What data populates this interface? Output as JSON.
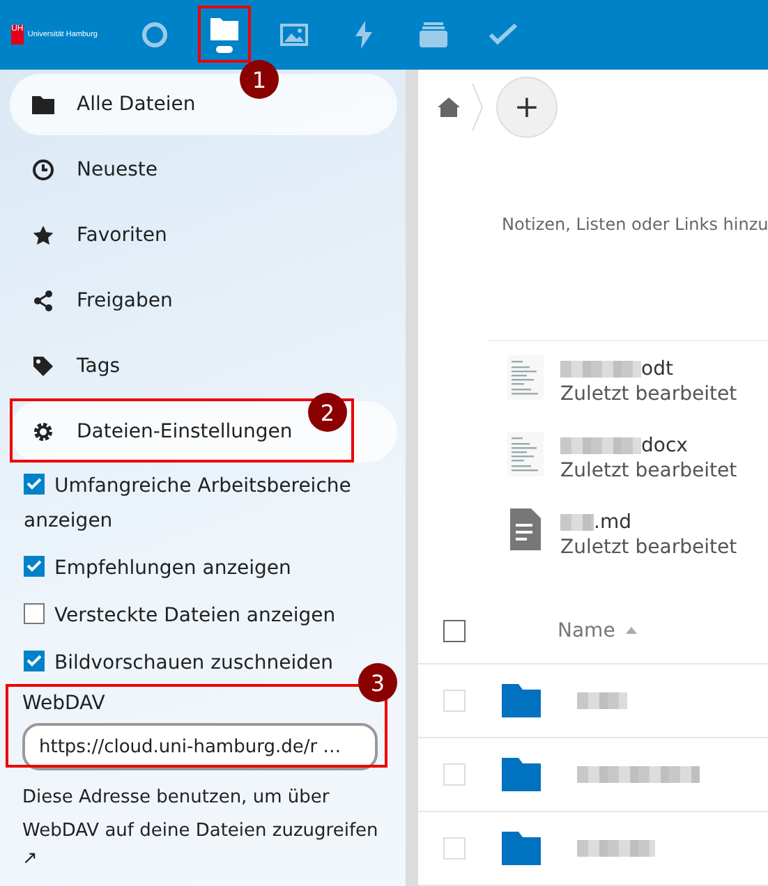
{
  "header": {
    "logo": {
      "mark": "UH",
      "name": "Universität Hamburg"
    },
    "apps": [
      {
        "kind": "circle",
        "selected": false
      },
      {
        "kind": "folder",
        "selected": true,
        "annotation": "1"
      },
      {
        "kind": "image",
        "selected": false
      },
      {
        "kind": "bolt",
        "selected": false
      },
      {
        "kind": "stack",
        "selected": false
      },
      {
        "kind": "check",
        "selected": false
      }
    ]
  },
  "sidebar": {
    "items": [
      {
        "kind": "folder",
        "label": "Alle Dateien",
        "selected": true
      },
      {
        "kind": "clock",
        "label": "Neueste",
        "selected": false
      },
      {
        "kind": "star",
        "label": "Favoriten",
        "selected": false
      },
      {
        "kind": "share",
        "label": "Freigaben",
        "selected": false
      },
      {
        "kind": "tag",
        "label": "Tags",
        "selected": false
      }
    ],
    "settings": {
      "label": "Dateien-Einstellungen",
      "expanded": true,
      "annotation": "2",
      "options": [
        {
          "label": "Umfangreiche Arbeitsbereiche anzeigen",
          "checked": true
        },
        {
          "label": "Empfehlungen anzeigen",
          "checked": true
        },
        {
          "label": "Versteckte Dateien anzeigen",
          "checked": false
        },
        {
          "label": "Bildvorschauen zuschneiden",
          "checked": true
        }
      ],
      "webdav": {
        "label": "WebDAV",
        "value": "https://cloud.uni-hamburg.de/r …",
        "annotation": "3",
        "description": "Diese Adresse benutzen, um über WebDAV auf deine Dateien zuzugreifen",
        "link": "↗"
      }
    }
  },
  "content": {
    "add_button": "+",
    "notes_hint": "Notizen, Listen oder Links hinzu",
    "recent": [
      {
        "kind": "document",
        "extension": "odt",
        "subtitle": "Zuletzt bearbeitet"
      },
      {
        "kind": "document",
        "extension": "docx",
        "subtitle": "Zuletzt bearbeitet"
      },
      {
        "kind": "text",
        "extension": ".md",
        "subtitle": "Zuletzt bearbeitet"
      }
    ],
    "table": {
      "select_all": {
        "checked": false
      },
      "columns": [
        "Name"
      ],
      "rows": [
        {
          "kind": "folder",
          "checked": false
        },
        {
          "kind": "folder",
          "checked": false
        },
        {
          "kind": "folder",
          "checked": false
        }
      ]
    }
  }
}
